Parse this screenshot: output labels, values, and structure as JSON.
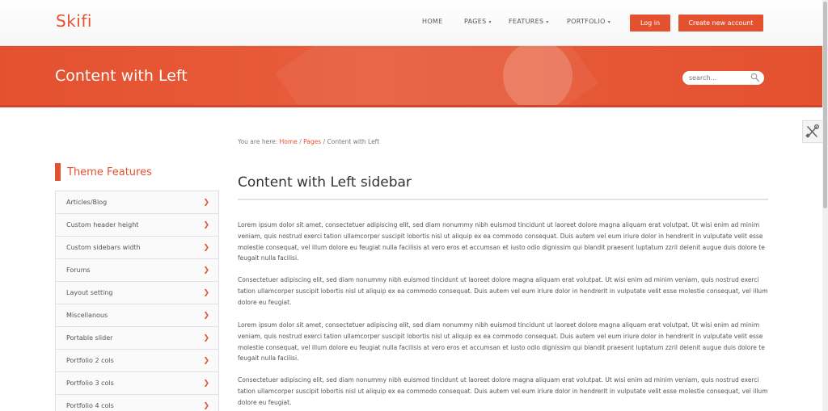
{
  "brand": {
    "logo": "Skifi",
    "accent": "#e4512f"
  },
  "nav": {
    "home": "HOME",
    "pages": "PAGES",
    "features": "FEATURES",
    "portfolio": "PORTFOLIO",
    "caret": "▾"
  },
  "auth": {
    "login": "Log in",
    "create": "Create new account"
  },
  "banner": {
    "title": "Content with Left",
    "search_placeholder": "search..."
  },
  "breadcrumb": {
    "prefix": "You are here:",
    "home": "Home",
    "sep": "/",
    "pages": "Pages",
    "current": "Content with Left"
  },
  "sidebar": {
    "title": "Theme Features",
    "chevron": "❯",
    "items": [
      {
        "label": "Articles/Blog"
      },
      {
        "label": "Custom header height"
      },
      {
        "label": "Custom sidebars width"
      },
      {
        "label": "Forums"
      },
      {
        "label": "Layout setting"
      },
      {
        "label": "Miscellanous"
      },
      {
        "label": "Portable slider"
      },
      {
        "label": "Portfolio 2 cols"
      },
      {
        "label": "Portfolio 3 cols"
      },
      {
        "label": "Portfolio 4 cols"
      }
    ]
  },
  "content": {
    "title": "Content with Left sidebar",
    "paragraphs": [
      "Lorem ipsum dolor sit amet, consectetuer adipiscing elit, sed diam nonummy nibh euismod tincidunt ut laoreet dolore magna aliquam erat volutpat. Ut wisi enim ad minim veniam, quis nostrud exerci tation ullamcorper suscipit lobortis nisl ut aliquip ex ea commodo consequat. Duis autem vel eum iriure dolor in hendrerit in vulputate velit esse molestie consequat, vel illum dolore eu feugiat nulla facilisis at vero eros et accumsan et iusto odio dignissim qui blandit praesent luptatum zzril delenit augue duis dolore te feugait nulla facilisi.",
      "Consectetuer adipiscing elit, sed diam nonummy nibh euismod tincidunt ut laoreet dolore magna aliquam erat volutpat. Ut wisi enim ad minim veniam, quis nostrud exerci tation ullamcorper suscipit lobortis nisl ut aliquip ex ea commodo consequat. Duis autem vel eum iriure dolor in hendrerit in vulputate velit esse molestie consequat, vel illum dolore eu feugiat.",
      "Lorem ipsum dolor sit amet, consectetuer adipiscing elit, sed diam nonummy nibh euismod tincidunt ut laoreet dolore magna aliquam erat volutpat. Ut wisi enim ad minim veniam, quis nostrud exerci tation ullamcorper suscipit lobortis nisl ut aliquip ex ea commodo consequat. Duis autem vel eum iriure dolor in hendrerit in vulputate velit esse molestie consequat, vel illum dolore eu feugiat nulla facilisis at vero eros et accumsan et iusto odio dignissim qui blandit praesent luptatum zzril delenit augue duis dolore te feugait nulla facilisi.",
      "Consectetuer adipiscing elit, sed diam nonummy nibh euismod tincidunt ut laoreet dolore magna aliquam erat volutpat. Ut wisi enim ad minim veniam, quis nostrud exerci tation ullamcorper suscipit lobortis nisl ut aliquip ex ea commodo consequat. Duis autem vel eum iriure dolor in hendrerit in vulputate velit esse molestie consequat, vel illum dolore eu feugiat."
    ]
  }
}
